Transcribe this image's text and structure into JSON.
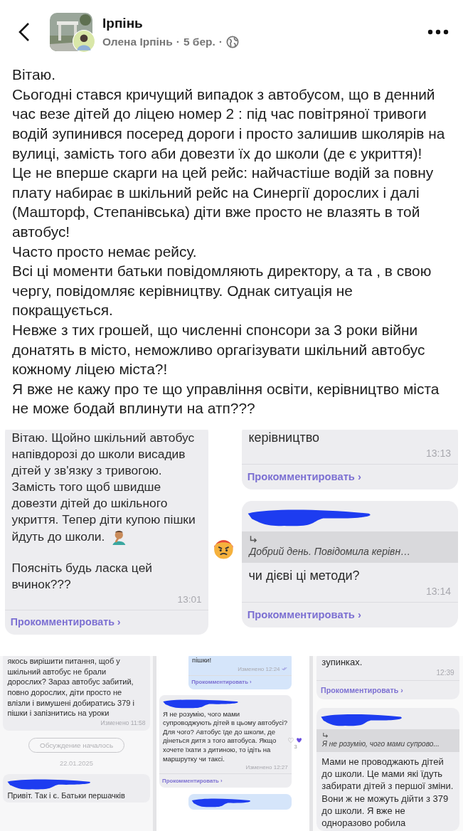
{
  "header": {
    "group_name": "Ірпінь",
    "author": "Олена Ірпінь",
    "separators": [
      "·",
      "·"
    ],
    "date": "5 бер."
  },
  "post_text": [
    "Вітаю.",
    "Сьогодні стався кричущий випадок з автобусом, що в денний час везе дітей до ліцею номер 2 : під час повітряної тривоги водій зупинився посеред дороги  і просто залишив школярів на вулиці, замість того аби довезти їх до школи (де є укриття)!",
    "Це не вперше скарги на цей рейс: найчастіше водій за повну плату набирає в шкільний рейс на Синергії дорослих і далі (Машторф, Степанівська) діти вже просто не влазять в той автобус!",
    "Часто просто немає рейсу.",
    "Всі ці моменти батьки повідомляють директору, а та , в свою чергу, повідомляє керівництву. Однак ситуація не покращується.",
    "Невже з тих грошей, що численні спонсори за 3 роки війни донатять в місто, неможливо оргагізувати шкільний автобус кожному ліцею міста?!",
    "Я вже не кажу про те що управління освіти, керівництво міста не може  бодай вплинути на атп???"
  ],
  "screenshots": [
    {
      "items": [
        {
          "kind": "message",
          "outgoing": false,
          "redacted": false,
          "has_emoji": true,
          "paragraphs": [
            "Вітаю. Щойно шкільний автобус напівдорозі до школи висадив дітей у зв'язку з тривогою. Замість того щоб швидше довезти дітей до шкільного укриття. Тепер діти купою пішки йдуть до школи.",
            "Поясніть будь ласка цей вчинок???"
          ],
          "time": "13:01",
          "comment_link": "Прокомментировать ›"
        }
      ]
    },
    {
      "items": [
        {
          "kind": "message",
          "outgoing": false,
          "redacted": false,
          "paragraphs": [
            "керівництво"
          ],
          "time": "13:13",
          "comment_link": "Прокомментировать ›"
        },
        {
          "kind": "message",
          "outgoing": false,
          "redacted": true,
          "reaction": {
            "kind": "angry"
          },
          "quote": "Добрий день. Повідомила керівн…",
          "paragraphs": [
            "чи дієві ці методи?"
          ],
          "time": "13:14",
          "comment_link": "Прокомментировать ›"
        }
      ]
    },
    {
      "items": [
        {
          "kind": "message",
          "outgoing": false,
          "redacted": false,
          "paragraphs": [
            "якось вирішити питання, щоб у шкільний автобус не брали дорослих? Зараз автобус забитий, повно дорослих, діти просто не влізли і вимушені добиратись 379 і пішки і запізнитись на уроки"
          ],
          "time": "Изменено 11:58"
        },
        {
          "kind": "pill",
          "text": "Обсуждение началось"
        },
        {
          "kind": "date",
          "text": "22.01.2025"
        },
        {
          "kind": "message",
          "outgoing": false,
          "redacted": true,
          "paragraphs": [
            "Привіт. Так і є. Батьки першачків"
          ]
        }
      ]
    },
    {
      "items": [
        {
          "kind": "message",
          "outgoing": true,
          "redacted": false,
          "read": true,
          "paragraphs": [
            "пішки!"
          ],
          "time": "Изменено 12:24",
          "comment_link": "Прокомментировать ›"
        },
        {
          "kind": "message",
          "outgoing": false,
          "redacted": true,
          "reaction": {
            "kind": "hearts",
            "count": "3"
          },
          "paragraphs": [
            "Я не розумію, чого мами супроводжують  дітей в цьому автобусі? Для чого? Автобус їде до школи, де дінеться дитя з того автобуса. Якщо хочете їхати з дитиною,  то ідіть на маршрутку чи таксі."
          ],
          "time": "Изменено 12:27",
          "comment_link": "Прокомментировать ›"
        },
        {
          "kind": "message",
          "outgoing": true,
          "redacted": true
        }
      ]
    },
    {
      "items": [
        {
          "kind": "message",
          "outgoing": false,
          "redacted": false,
          "paragraphs": [
            "зупинках."
          ],
          "time": "12:39",
          "comment_link": "Прокомментировать ›"
        },
        {
          "kind": "message",
          "outgoing": false,
          "redacted": true,
          "quote": "Я не розумію, чого мами супрово...",
          "paragraphs": [
            "Мами не проводжають дітей до школи. Це мами які їдуть забирати дітей з першої зміни. Вони ж не можуть дійти з 379 до школи. Я вже не одноразово робила"
          ]
        }
      ]
    }
  ]
}
